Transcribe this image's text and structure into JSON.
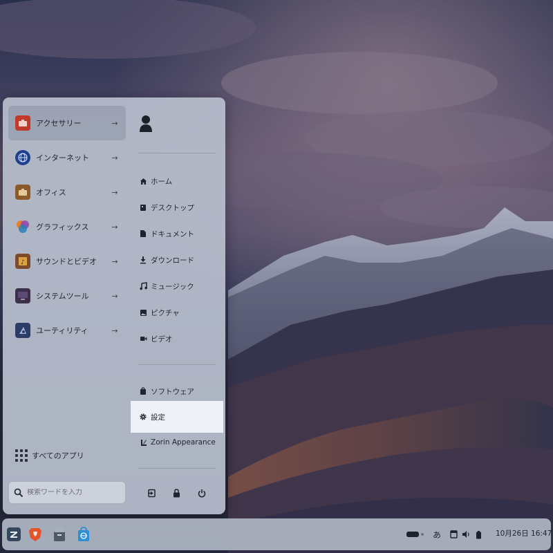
{
  "start_menu": {
    "categories": [
      {
        "label": "アクセサリー",
        "icon": "toolbox-icon",
        "color": "#c0392b"
      },
      {
        "label": "インターネット",
        "icon": "globe-icon",
        "color": "#1f3f8a"
      },
      {
        "label": "オフィス",
        "icon": "briefcase-icon",
        "color": "#8a5a2b"
      },
      {
        "label": "グラフィックス",
        "icon": "palette-icon",
        "color": "#d35400"
      },
      {
        "label": "サウンドとビデオ",
        "icon": "media-icon",
        "color": "#7b4b2a"
      },
      {
        "label": "システムツール",
        "icon": "monitor-icon",
        "color": "#3b2f4a"
      },
      {
        "label": "ユーティリティ",
        "icon": "utility-icon",
        "color": "#2c3e66"
      }
    ],
    "arrow_glyph": "→",
    "all_apps_label": "すべてのアプリ",
    "search_placeholder": "検索ワードを入力",
    "places": [
      {
        "label": "ホーム",
        "icon": "home-icon"
      },
      {
        "label": "デスクトップ",
        "icon": "desktop-icon"
      },
      {
        "label": "ドキュメント",
        "icon": "document-icon"
      },
      {
        "label": "ダウンロード",
        "icon": "download-icon"
      },
      {
        "label": "ミュージック",
        "icon": "music-icon"
      },
      {
        "label": "ピクチャ",
        "icon": "picture-icon"
      },
      {
        "label": "ビデオ",
        "icon": "video-icon"
      }
    ],
    "apps": [
      {
        "label": "ソフトウェア",
        "icon": "software-bag-icon"
      },
      {
        "label": "設定",
        "icon": "gear-icon"
      },
      {
        "label": "Zorin Appearance",
        "icon": "zorin-appearance-icon"
      }
    ],
    "actions": [
      "logout-icon",
      "lock-icon",
      "power-icon"
    ]
  },
  "taskbar": {
    "apps": [
      "zorin-menu-icon",
      "brave-browser-icon",
      "files-icon",
      "software-store-icon"
    ],
    "tray": {
      "ime_label": "あ",
      "clock": "10月26日 16:47"
    }
  },
  "colors": {
    "menu_bg": "#b8becc",
    "highlight": "#eef1f7",
    "taskbar_bg": "#b0b6c4"
  }
}
